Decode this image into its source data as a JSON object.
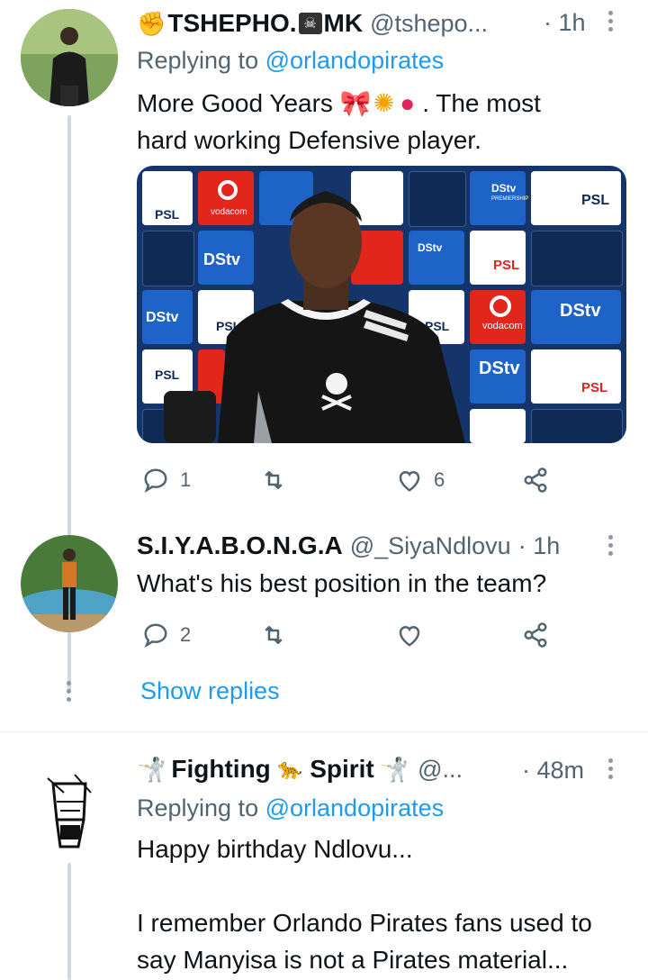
{
  "tweets": [
    {
      "name": "TSHEPHO.",
      "name_suffix": "MK",
      "handle": "@tshepo...",
      "time": "· 1h",
      "reply_prefix": "Replying to",
      "reply_to": "@orlandopirates",
      "text_line1": "More Good Years",
      "text_line1_end": ". The most",
      "text_line2": "hard working Defensive player.",
      "media_text": {
        "logo_psl": "PSL",
        "logo_dstv": "DStv",
        "logo_vodacom": "vodacom",
        "logo_premiership": "PREMIERSHIP"
      },
      "reply_count": "1",
      "like_count": "6"
    },
    {
      "name": "S.I.Y.A.B.O.N.G.A",
      "handle": "@_SiyaNdlovu",
      "time": "· 1h",
      "text": "What's his best position in the team?",
      "reply_count": "2",
      "show_replies": "Show replies"
    },
    {
      "name_part1": "Fighting",
      "name_part2": "Spirit",
      "handle": "@...",
      "time": "· 48m",
      "reply_prefix": "Replying to",
      "reply_to": "@orlandopirates",
      "text_line1": "Happy birthday Ndlovu...",
      "text_line2": "I remember Orlando Pirates fans used to",
      "text_line3": "say Manyisa is not a Pirates material..."
    }
  ],
  "colors": {
    "link": "#1d9bf0",
    "muted": "#536471",
    "thread_line": "#cfd9de",
    "tile_blue": "#1e63c8",
    "tile_red": "#e2261c",
    "tile_navy": "#0e2a55"
  },
  "icons": [
    "reply-icon",
    "retweet-icon",
    "like-icon",
    "share-icon",
    "more-icon",
    "skull-icon",
    "ribbon-emoji",
    "balloon-emoji",
    "confetti-emoji",
    "fencer-emoji",
    "leopard-emoji"
  ]
}
